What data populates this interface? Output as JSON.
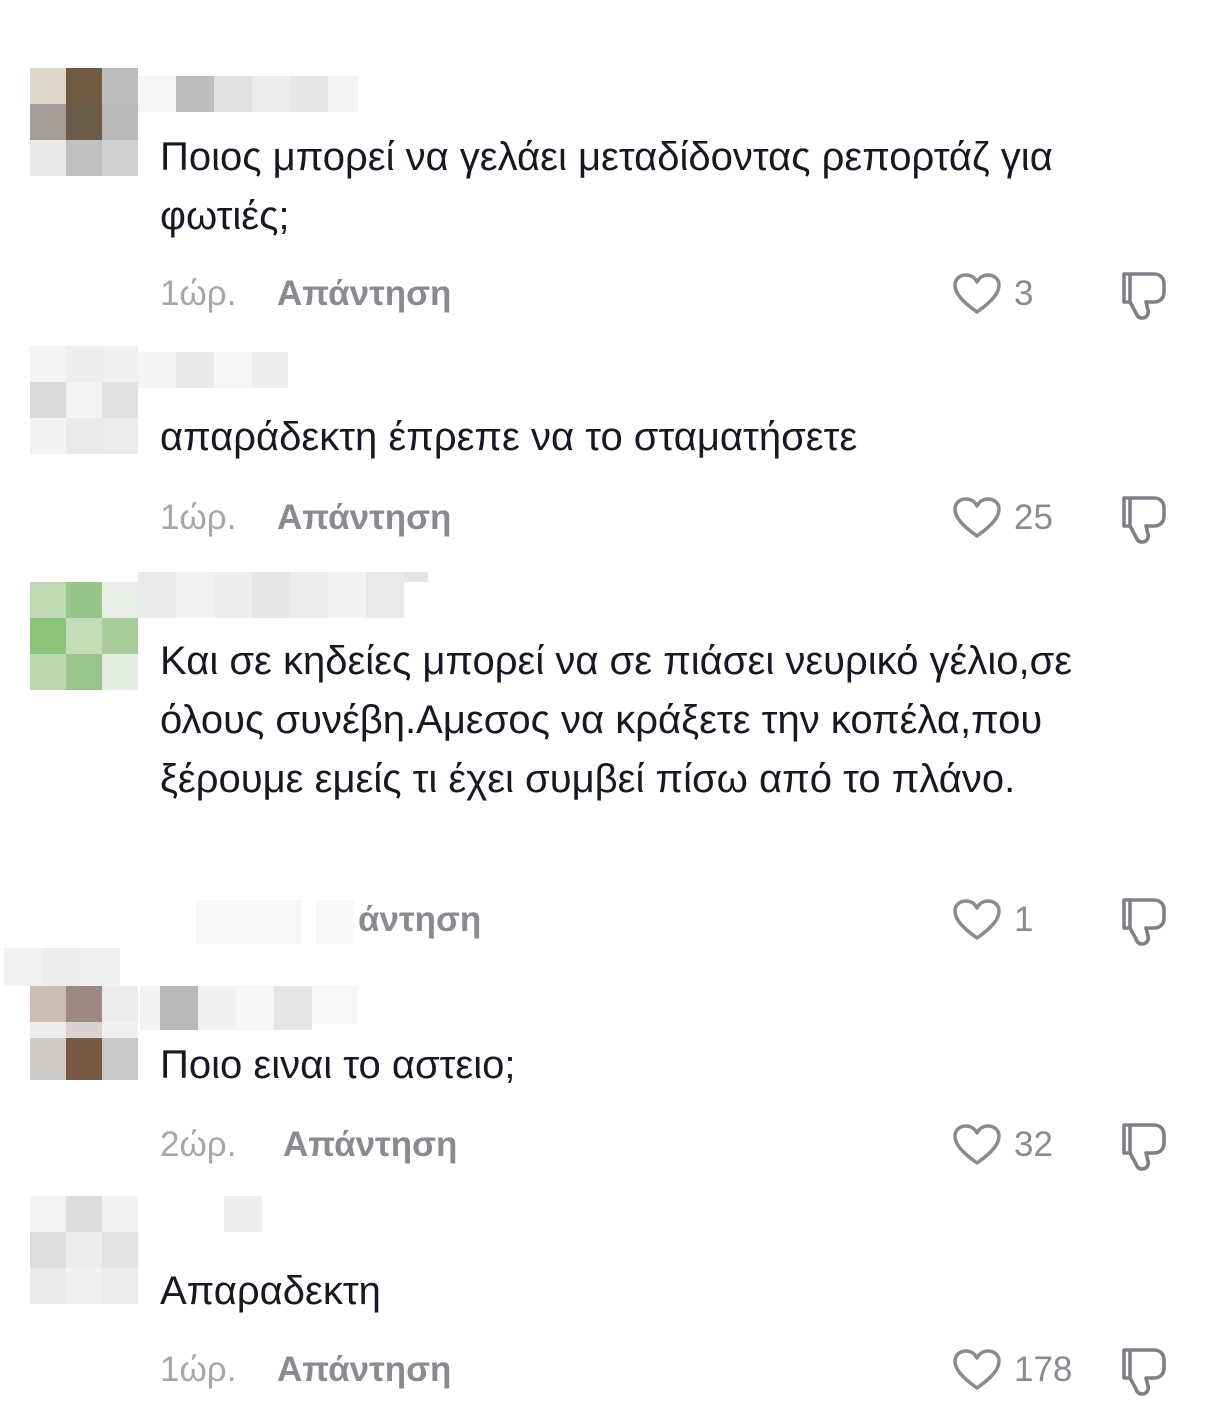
{
  "icons": {
    "like": "heart-outline-icon",
    "dislike": "thumbs-down-icon"
  },
  "colors": {
    "text": "#161823",
    "meta": "#a7a7ab",
    "action": "#8a8b91"
  },
  "comments": [
    {
      "text": "Ποιος μπορεί να γελάει μεταδίδοντας ρεπορτάζ για φωτιές;",
      "time": "1ώρ.",
      "reply": "Απάντηση",
      "likes": "3"
    },
    {
      "text": "απαράδεκτη έπρεπε να το σταματήσετε",
      "time": "1ώρ.",
      "reply": "Απάντηση",
      "likes": "25"
    },
    {
      "text": "Και σε κηδείες μπορεί να σε πιάσει νευρικό γέλιο,σε όλους συνέβη.Αμεσος να κράξετε την κοπέλα,που ξέρουμε εμείς τι έχει συμβεί πίσω από το πλάνο.",
      "time": "",
      "reply": "άντηση",
      "likes": "1"
    },
    {
      "text": "Ποιο ειναι το αστειο;",
      "time": "2ώρ.",
      "reply": "Απάντηση",
      "likes": "32"
    },
    {
      "text": "Απαραδεκτη",
      "time": "1ώρ.",
      "reply": "Απάντηση",
      "likes": "178"
    }
  ]
}
